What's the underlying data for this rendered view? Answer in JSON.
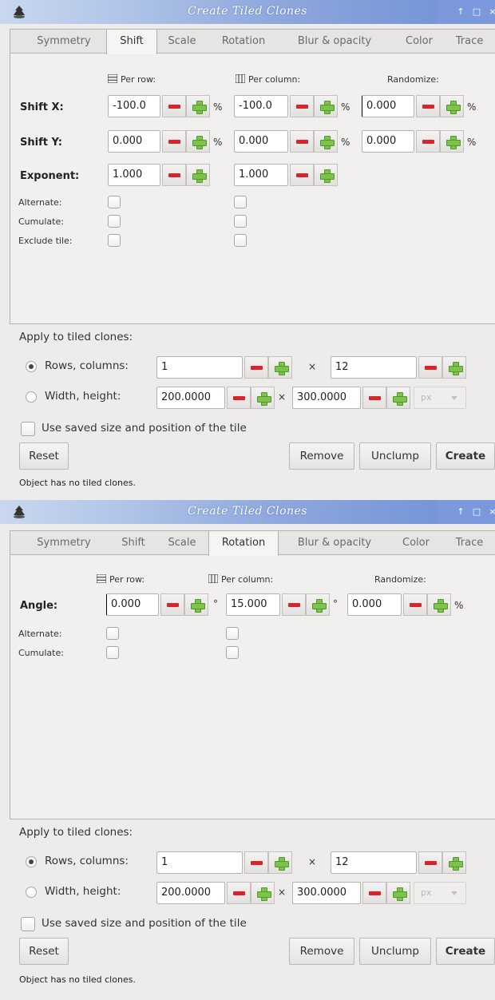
{
  "window": {
    "title": "Create Tiled Clones",
    "controls": [
      "↑",
      "□",
      "×"
    ]
  },
  "tabs": [
    "Symmetry",
    "Shift",
    "Scale",
    "Rotation",
    "Blur & opacity",
    "Color",
    "Trace"
  ],
  "column_headers": {
    "per_row": "Per row:",
    "per_column": "Per column:",
    "randomize": "Randomize:"
  },
  "shift_panel": {
    "active_tab": "Shift",
    "rows": [
      {
        "label": "Shift X:",
        "per_row": "-100.0",
        "per_row_unit": "%",
        "per_column": "-100.0",
        "per_column_unit": "%",
        "randomize": "0.000",
        "randomize_unit": "%"
      },
      {
        "label": "Shift Y:",
        "per_row": "0.000",
        "per_row_unit": "%",
        "per_column": "0.000",
        "per_column_unit": "%",
        "randomize": "0.000",
        "randomize_unit": "%"
      },
      {
        "label": "Exponent:",
        "per_row": "1.000",
        "per_column": "1.000"
      }
    ],
    "checks": [
      "Alternate:",
      "Cumulate:",
      "Exclude tile:"
    ]
  },
  "rotation_panel": {
    "active_tab": "Rotation",
    "rows": [
      {
        "label": "Angle:",
        "per_row": "0.000",
        "per_row_unit": "°",
        "per_column": "15.000",
        "per_column_unit": "°",
        "randomize": "0.000",
        "randomize_unit": "%"
      }
    ],
    "checks": [
      "Alternate:",
      "Cumulate:"
    ]
  },
  "apply": {
    "heading": "Apply to tiled clones:",
    "rows_columns_label": "Rows, columns:",
    "rows_value": "1",
    "times": "×",
    "columns_value": "12",
    "width_height_label": "Width, height:",
    "width_value": "200.0000",
    "height_value": "300.0000",
    "unit": "px",
    "use_saved_label": "Use saved size and position of the tile",
    "selected": "rows_columns"
  },
  "buttons": {
    "reset": "Reset",
    "remove": "Remove",
    "unclump": "Unclump",
    "create": "Create"
  },
  "status": "Object has no tiled clones.",
  "colors": {
    "title_grad_start": "#c9d7ee",
    "title_grad_end": "#6d8fd6",
    "minus": "#d9242d",
    "plus": "#7ec24b"
  }
}
